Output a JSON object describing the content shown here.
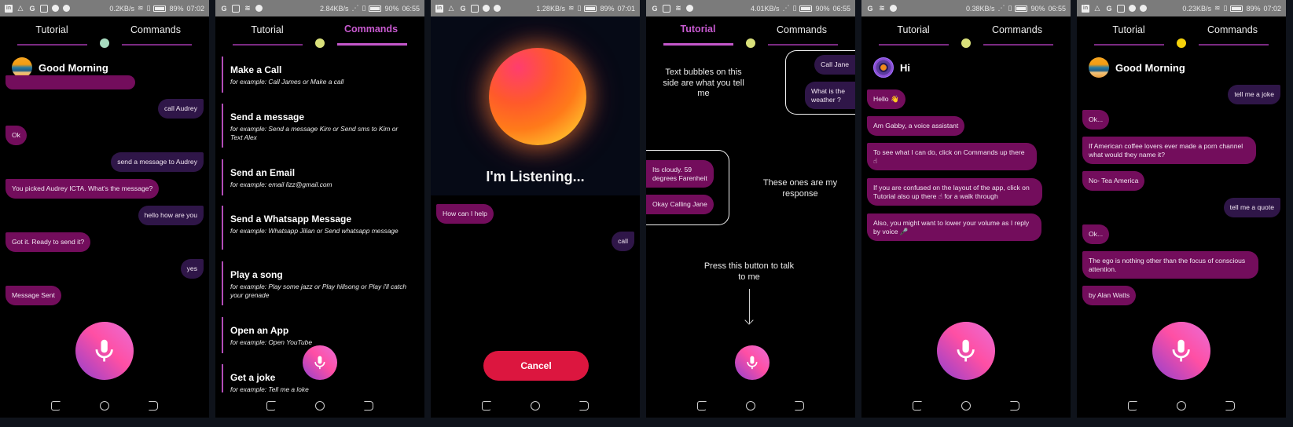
{
  "colors": {
    "bot_bubble": "#730d5c",
    "user_bubble": "#2f1648",
    "accent": "#c457cb",
    "cancel": "#dc163f",
    "status_bar": "#7b7b7b"
  },
  "tabs": {
    "tutorial": "Tutorial",
    "commands": "Commands"
  },
  "screens": [
    {
      "status": {
        "speed": "0.2KB/s",
        "battery": "89%",
        "time": "07:02",
        "icons": [
          "linkedin-icon",
          "drive-icon",
          "google-icon",
          "cast-icon",
          "chat-icon",
          "shield-icon"
        ]
      },
      "active_tab": "none",
      "indicator_color": "#a8dcc0",
      "greeting": "Good Morning",
      "messages": [
        {
          "from": "user",
          "text": "call Audrey"
        },
        {
          "from": "bot",
          "text": "Ok"
        },
        {
          "from": "user",
          "text": "send a message to Audrey"
        },
        {
          "from": "bot",
          "text": "You picked Audrey ICTA. What's the message?"
        },
        {
          "from": "user",
          "text": "hello how are you"
        },
        {
          "from": "bot",
          "text": "Got it. Ready to send it?"
        },
        {
          "from": "user",
          "text": "yes"
        },
        {
          "from": "bot",
          "text": "Message Sent"
        }
      ]
    },
    {
      "status": {
        "speed": "2.84KB/s",
        "battery": "90%",
        "time": "06:55",
        "icons": [
          "google-icon",
          "cast-icon",
          "wifi-icon",
          "shield-icon"
        ]
      },
      "active_tab": "commands",
      "indicator_color": "#d9e07a",
      "commands": [
        {
          "title": "Make a Call",
          "example": "for example: Call James or Make a call"
        },
        {
          "title": "Send a message",
          "example": "for example: Send a message Kim or Send sms to Kim or Text Alex"
        },
        {
          "title": "Send an Email",
          "example": "for example: email lizz@gmail.com"
        },
        {
          "title": "Send a Whatsapp Message",
          "example": "for example: Whatsapp Jilian or Send whatsapp message"
        },
        {
          "title": "Play a song",
          "example": "for example: Play some jazz or Play hillsong or Play i'll catch your grenade"
        },
        {
          "title": "Open an App",
          "example": "for example: Open YouTube"
        },
        {
          "title": "Get a joke",
          "example": "for example: Tell me a loke"
        }
      ]
    },
    {
      "status": {
        "speed": "1.28KB/s",
        "battery": "89%",
        "time": "07:01",
        "icons": [
          "linkedin-icon",
          "drive-icon",
          "google-icon",
          "cast-icon",
          "chat-icon",
          "shield-icon"
        ]
      },
      "listening_text": "I'm Listening...",
      "messages": [
        {
          "from": "bot",
          "text": "How can I help"
        },
        {
          "from": "user",
          "text": "call"
        }
      ],
      "cancel_label": "Cancel"
    },
    {
      "status": {
        "speed": "4.01KB/s",
        "battery": "90%",
        "time": "06:55",
        "icons": [
          "google-icon",
          "cast-icon",
          "wifi-icon",
          "shield-icon"
        ]
      },
      "active_tab": "tutorial",
      "indicator_color": "#d9e07a",
      "user_explain": "Text bubbles on this side are what you tell me",
      "user_examples": [
        "Call Jane",
        "What is the weather ?"
      ],
      "bot_examples": [
        "Its cloudy. 59 degrees Farenheit",
        "Okay Calling Jane"
      ],
      "bot_explain": "These ones are my response",
      "press_hint": "Press this button to talk to me"
    },
    {
      "status": {
        "speed": "0.38KB/s",
        "battery": "90%",
        "time": "06:55",
        "icons": [
          "google-icon",
          "wifi-icon",
          "shield-icon"
        ]
      },
      "active_tab": "none",
      "indicator_color": "#d9e07a",
      "greeting": "Hi",
      "messages": [
        {
          "from": "bot",
          "text": "Hello 👋"
        },
        {
          "from": "bot",
          "text": "Am Gabby, a voice assistant"
        },
        {
          "from": "bot",
          "text": "To see what I can do, click on Commands up there ☝"
        },
        {
          "from": "bot",
          "text": "If you are confused on the layout of the app, click on Tutorial also up there ☝  for a walk through"
        },
        {
          "from": "bot",
          "text": "Also, you might want to lower your volume as I reply by voice 🎤"
        }
      ]
    },
    {
      "status": {
        "speed": "0.23KB/s",
        "battery": "89%",
        "time": "07:02",
        "icons": [
          "linkedin-icon",
          "drive-icon",
          "google-icon",
          "cast-icon",
          "chat-icon",
          "shield-icon"
        ]
      },
      "active_tab": "none",
      "indicator_color": "#f5d20a",
      "greeting": "Good Morning",
      "messages": [
        {
          "from": "user",
          "text": "tell me a joke"
        },
        {
          "from": "bot",
          "text": "Ok..."
        },
        {
          "from": "bot",
          "text": "If American coffee lovers ever made a porn channel what would they name it?"
        },
        {
          "from": "bot",
          "text": "No- Tea America"
        },
        {
          "from": "user",
          "text": "tell me a quote"
        },
        {
          "from": "bot",
          "text": "Ok..."
        },
        {
          "from": "bot",
          "text": "The ego is nothing other than the focus of conscious attention."
        },
        {
          "from": "bot",
          "text": "by Alan Watts"
        }
      ]
    }
  ]
}
